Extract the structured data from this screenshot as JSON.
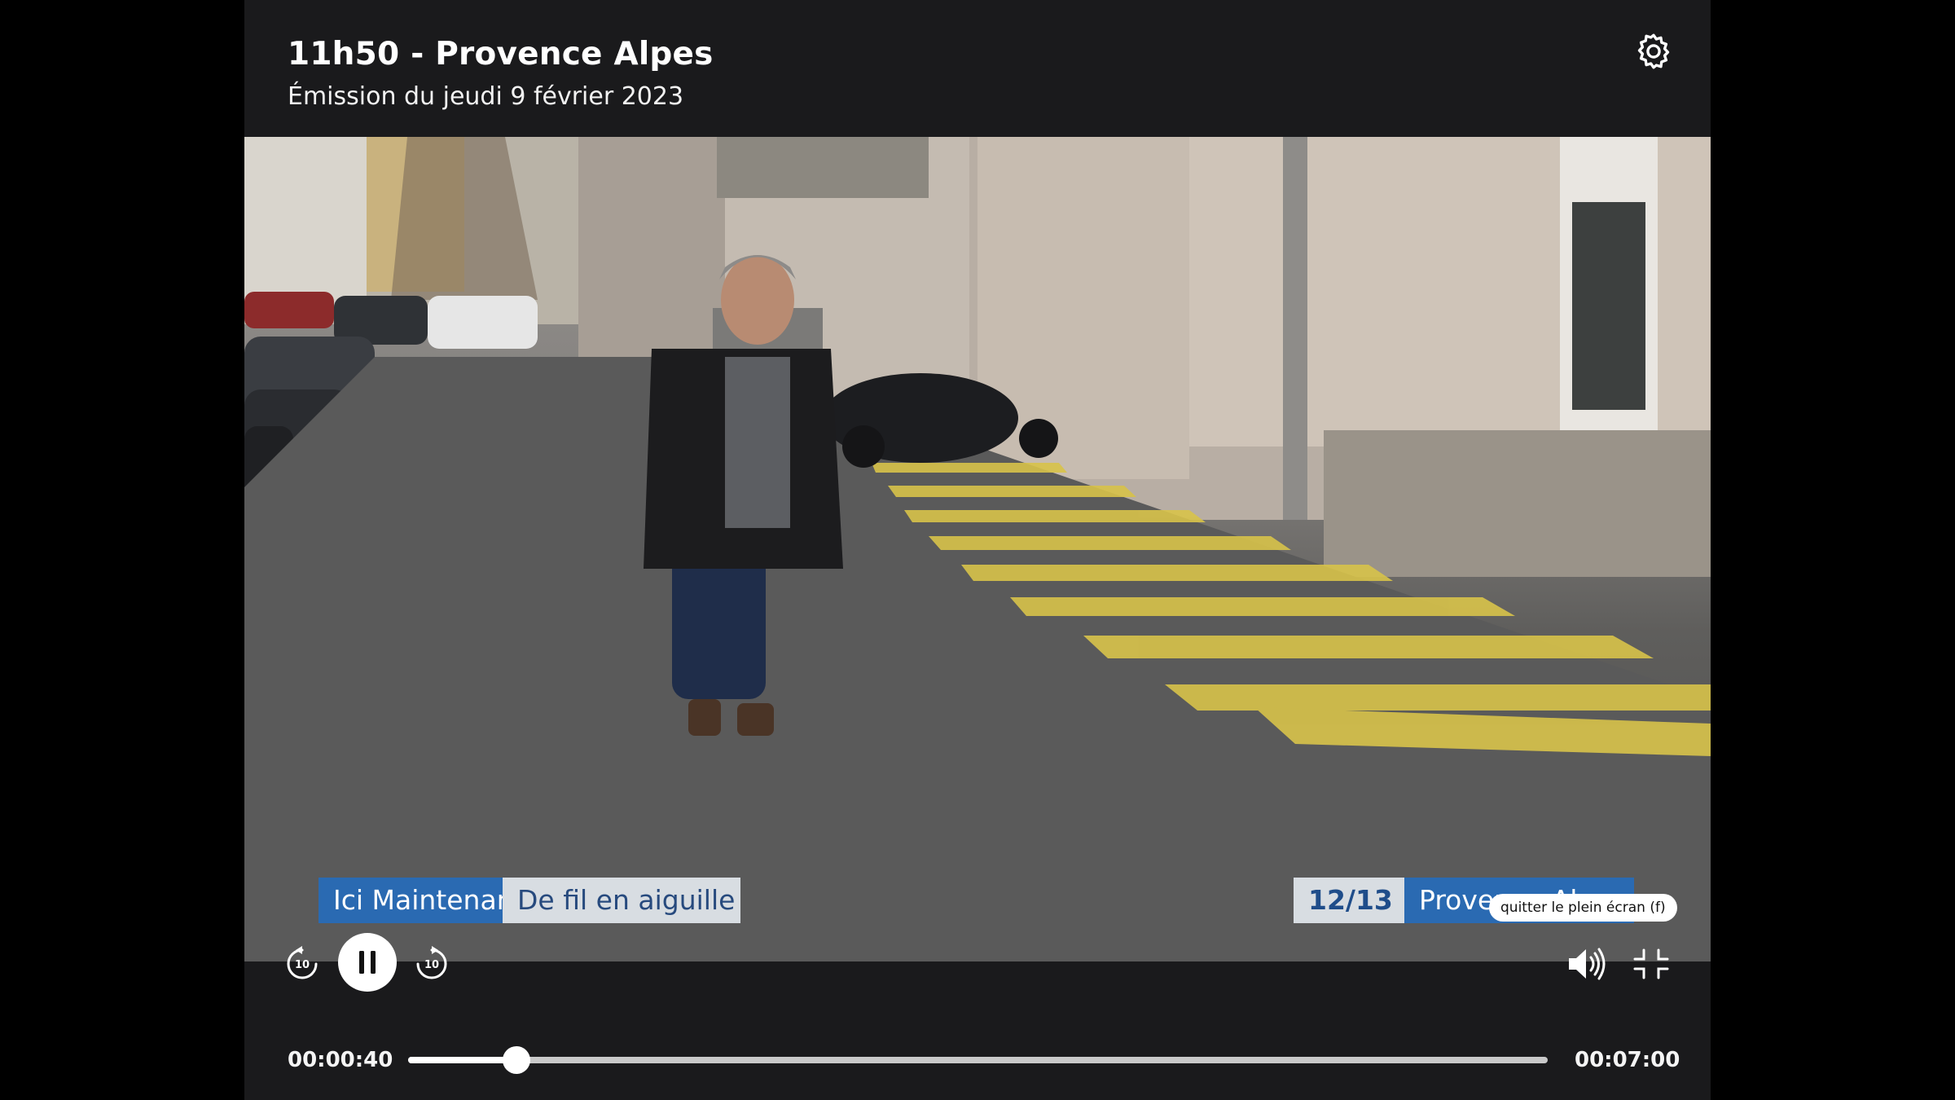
{
  "header": {
    "title": "11h50 - Provence Alpes",
    "subtitle": "Émission du jeudi 9 février 2023"
  },
  "video": {
    "banner_left_1": "Ici Maintenant",
    "banner_left_2": "De fil en aiguille",
    "banner_right_1": "12/13",
    "banner_right_2": "Provence-Alpes",
    "tooltip": "quitter le plein écran (f)"
  },
  "controls": {
    "rewind_icon": "rewind-10-icon",
    "rewind_label": "10",
    "forward_icon": "forward-10-icon",
    "forward_label": "10",
    "play_state": "pause-icon",
    "volume_icon": "volume-icon",
    "exit_fullscreen_icon": "exit-fullscreen-icon",
    "settings_icon": "gear-icon"
  },
  "timeline": {
    "current": "00:00:40",
    "total": "00:07:00",
    "progress_fraction": 0.095
  }
}
